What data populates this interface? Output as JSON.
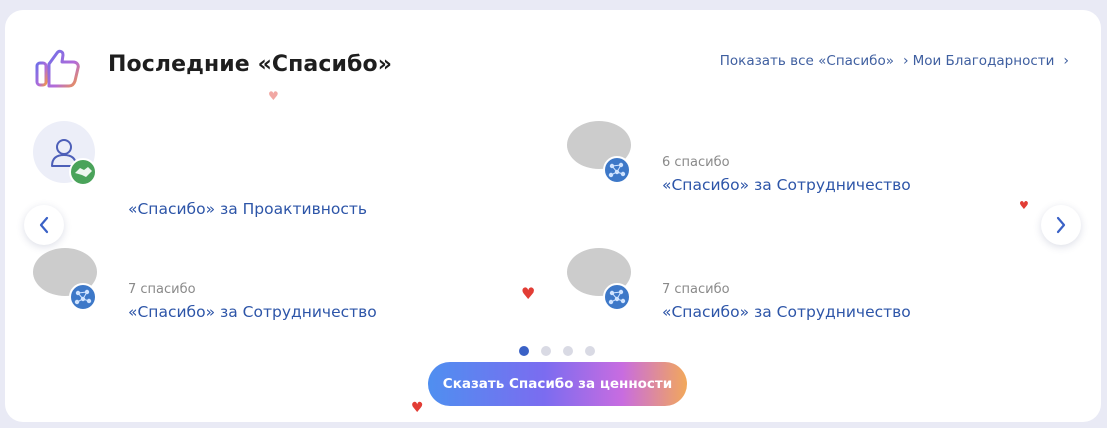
{
  "header": {
    "title": "Последние «Спасибо»",
    "show_all_label": "Показать все «Спасибо»",
    "my_thanks_label": "Мои Благодарности"
  },
  "items": [
    {
      "count": "",
      "reason": "«Спасибо» за Проактивность",
      "badge": "handshake-badge-icon"
    },
    {
      "count": "6 спасибо",
      "reason": "«Спасибо» за Сотрудничество",
      "badge": "network-badge-icon"
    },
    {
      "count": "7 спасибо",
      "reason": "«Спасибо» за Сотрудничество",
      "badge": "network-badge-icon"
    },
    {
      "count": "7 спасибо",
      "reason": "«Спасибо» за Сотрудничество",
      "badge": "network-badge-icon"
    }
  ],
  "pagination": {
    "total": 4,
    "active": 1
  },
  "cta": {
    "label": "Сказать Спасибо за ценности"
  },
  "colors": {
    "accent": "#2d55a8",
    "heart": "#e23d35",
    "dot_active": "#3a61c6",
    "dot_inactive": "#d9dae4",
    "cta_gradient": [
      "#4f8ff0",
      "#7b6cf0",
      "#c86ce0",
      "#f2a85a"
    ]
  }
}
